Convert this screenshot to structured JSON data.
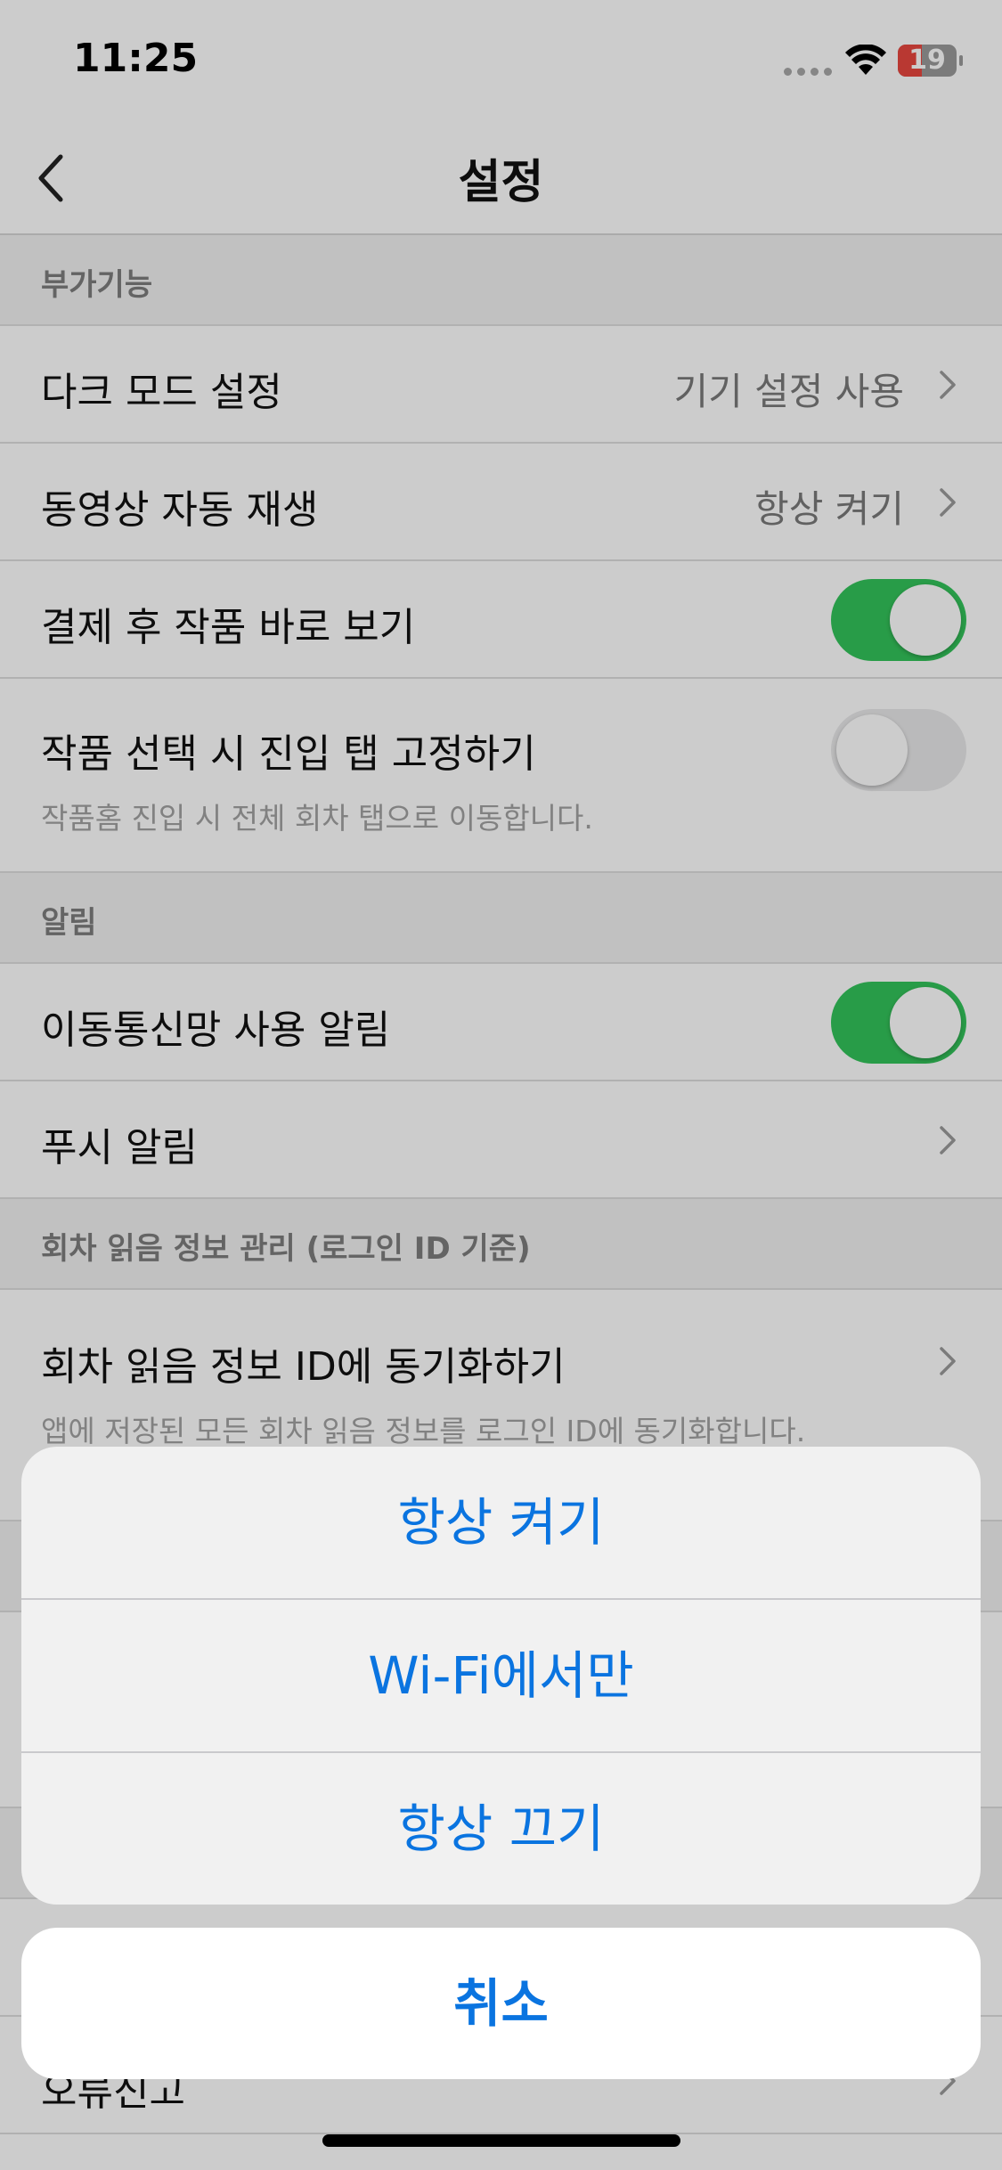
{
  "status_bar": {
    "time": "11:25",
    "battery": "19",
    "battery_level_percent": 19
  },
  "nav": {
    "title": "설정"
  },
  "sections": {
    "extras": {
      "header": "부가기능",
      "dark_mode": {
        "label": "다크 모드 설정",
        "value": "기기 설정 사용"
      },
      "autoplay": {
        "label": "동영상 자동 재생",
        "value": "항상 켜기"
      },
      "view_after_payment": {
        "label": "결제 후 작품 바로 보기",
        "toggle": true
      },
      "fix_tab": {
        "label": "작품 선택 시 진입 탭 고정하기",
        "sub": "작품홈 진입 시 전체 회차 탭으로 이동합니다.",
        "toggle": false
      }
    },
    "alerts": {
      "header": "알림",
      "mobile_data": {
        "label": "이동통신망 사용 알림",
        "toggle": true
      },
      "push": {
        "label": "푸시 알림"
      }
    },
    "read_info": {
      "header": "회차 읽음 정보 관리 (로그인 ID 기준)",
      "sync": {
        "label": "회차 읽음 정보 ID에 동기화하기",
        "sub": "앱에 저장된 모든 회차 읽음 정보를 로그인 ID에 동기화합니다."
      }
    },
    "partial_row": {
      "label": "오류신고"
    }
  },
  "action_sheet": {
    "options": [
      "항상 켜기",
      "Wi-Fi에서만",
      "항상 끄기"
    ],
    "cancel": "취소"
  },
  "colors": {
    "accent": "#0a74e0",
    "toggle_on": "#33c35a"
  }
}
